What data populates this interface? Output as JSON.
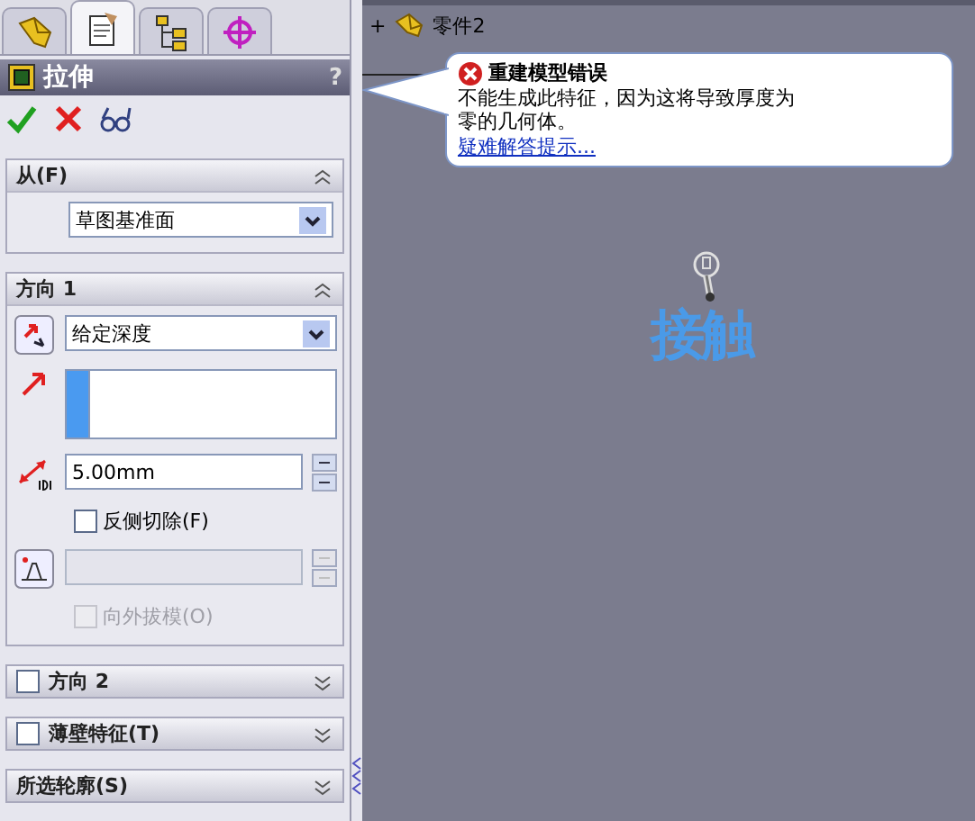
{
  "panel_tabs": [
    {
      "kind": "features",
      "selected": false
    },
    {
      "kind": "properties",
      "selected": true
    },
    {
      "kind": "configurations",
      "selected": false
    },
    {
      "kind": "display",
      "selected": false
    }
  ],
  "panel_title": {
    "text": "拉伸",
    "help": "?"
  },
  "actions": [
    {
      "kind": "ok"
    },
    {
      "kind": "cancel"
    },
    {
      "kind": "preview"
    }
  ],
  "sections": [
    {
      "title": "从(F)",
      "expanded": true,
      "rows": [
        {
          "kind": "combo",
          "value": "草图基准面"
        }
      ]
    },
    {
      "title": "方向 1",
      "expanded": true,
      "rows": [
        {
          "kind": "reverse",
          "value": "给定深度"
        },
        {
          "kind": "picker"
        },
        {
          "kind": "depth",
          "value": "5.00mm",
          "disabled": false
        },
        {
          "kind": "check",
          "label": "反侧切除(F)",
          "checked": false,
          "disabled": false
        },
        {
          "kind": "draft",
          "disabled": true
        },
        {
          "kind": "check",
          "label": "向外拔模(O)",
          "checked": false,
          "disabled": true
        }
      ]
    },
    {
      "title": "方向 2",
      "expanded": false,
      "checkbox": {
        "checked": false
      }
    },
    {
      "title": "薄壁特征(T)",
      "expanded": false,
      "checkbox": {
        "checked": false
      }
    },
    {
      "title": "所选轮廓(S)",
      "expanded": false
    }
  ],
  "tree": {
    "expander": "+",
    "label": "零件2"
  },
  "error_balloon": {
    "title": "重建模型错误",
    "message": "不能生成此特征，因为这将导致厚度为零的几何体。",
    "link": "疑难解答提示..."
  },
  "canvas_note": "接触"
}
